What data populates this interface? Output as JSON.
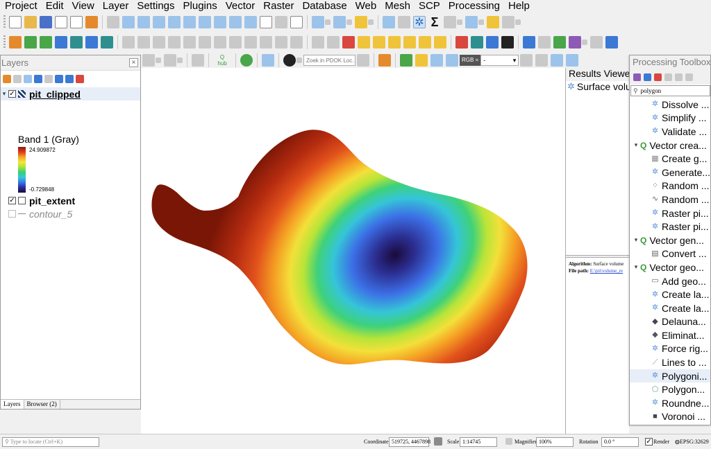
{
  "menubar": [
    "Project",
    "Edit",
    "View",
    "Layer",
    "Settings",
    "Plugins",
    "Vector",
    "Raster",
    "Database",
    "Web",
    "Mesh",
    "SCP",
    "Processing",
    "Help"
  ],
  "toolbar": {
    "locate_placeholder": "Zoek in PDOK Loc…",
    "rgb_label": "RGB =",
    "rgb_value": "-",
    "hub_label": "hub"
  },
  "layers_panel": {
    "title": "Layers",
    "layers": [
      {
        "name": "pit_clipped",
        "checked": true,
        "selected": true
      },
      {
        "name": "pit_extent",
        "checked": true
      },
      {
        "name": "contour_5",
        "checked": false,
        "dimmed": true
      }
    ],
    "band_label": "Band 1 (Gray)",
    "ramp_max": "24.909872",
    "ramp_min": "-0.729848",
    "tabs": [
      "Layers",
      "Browser (2)"
    ]
  },
  "results_viewer": {
    "title": "Results Viewer",
    "item": "Surface volume",
    "algorithm_label": "Algorithm:",
    "algorithm_value": "Surface volume",
    "file_label": "File path:",
    "file_value": "E:\\pit\\volume_re"
  },
  "processing_toolbox": {
    "title": "Processing Toolbox",
    "search": "polygon",
    "rows": [
      {
        "label": "Dissolve ...",
        "level": 2,
        "icon": "gear-icon"
      },
      {
        "label": "Simplify ...",
        "level": 2,
        "icon": "gear-icon"
      },
      {
        "label": "Validate ...",
        "level": 2,
        "icon": "gear-icon"
      },
      {
        "label": "Vector crea...",
        "level": 1,
        "icon": "qgis-icon"
      },
      {
        "label": "Create g...",
        "level": 2,
        "icon": "grid-icon"
      },
      {
        "label": "Generate...",
        "level": 2,
        "icon": "gear-icon"
      },
      {
        "label": "Random ...",
        "level": 2,
        "icon": "random-points-icon"
      },
      {
        "label": "Random ...",
        "level": 2,
        "icon": "random-line-icon"
      },
      {
        "label": "Raster pi...",
        "level": 2,
        "icon": "gear-icon"
      },
      {
        "label": "Raster pi...",
        "level": 2,
        "icon": "gear-icon"
      },
      {
        "label": "Vector gen...",
        "level": 1,
        "icon": "qgis-icon"
      },
      {
        "label": "Convert ...",
        "level": 2,
        "icon": "convert-icon"
      },
      {
        "label": "Vector geo...",
        "level": 1,
        "icon": "qgis-icon"
      },
      {
        "label": "Add geo...",
        "level": 2,
        "icon": "table-icon"
      },
      {
        "label": "Create la...",
        "level": 2,
        "icon": "gear-icon"
      },
      {
        "label": "Create la...",
        "level": 2,
        "icon": "gear-icon"
      },
      {
        "label": "Delauna...",
        "level": 2,
        "icon": "delaunay-icon"
      },
      {
        "label": "Eliminat...",
        "level": 2,
        "icon": "eliminate-icon"
      },
      {
        "label": "Force rig...",
        "level": 2,
        "icon": "gear-icon"
      },
      {
        "label": "Lines to ...",
        "level": 2,
        "icon": "lines-icon"
      },
      {
        "label": "Polygoni...",
        "level": 2,
        "icon": "gear-icon",
        "selected": true
      },
      {
        "label": "Polygon...",
        "level": 2,
        "icon": "polygon-icon"
      },
      {
        "label": "Roundne...",
        "level": 2,
        "icon": "gear-icon"
      },
      {
        "label": "Voronoi ...",
        "level": 2,
        "icon": "voronoi-icon"
      }
    ]
  },
  "statusbar": {
    "locate_placeholder": "Type to locate (Ctrl+K)",
    "coordinate_label": "Coordinate",
    "coordinate_value": "519725, 4467898",
    "scale_label": "Scale",
    "scale_value": "1:14745",
    "magnifier_label": "Magnifier",
    "magnifier_value": "100%",
    "rotation_label": "Rotation",
    "rotation_value": "0.0 °",
    "render_label": "Render",
    "crs_label": "EPSG:32629"
  }
}
